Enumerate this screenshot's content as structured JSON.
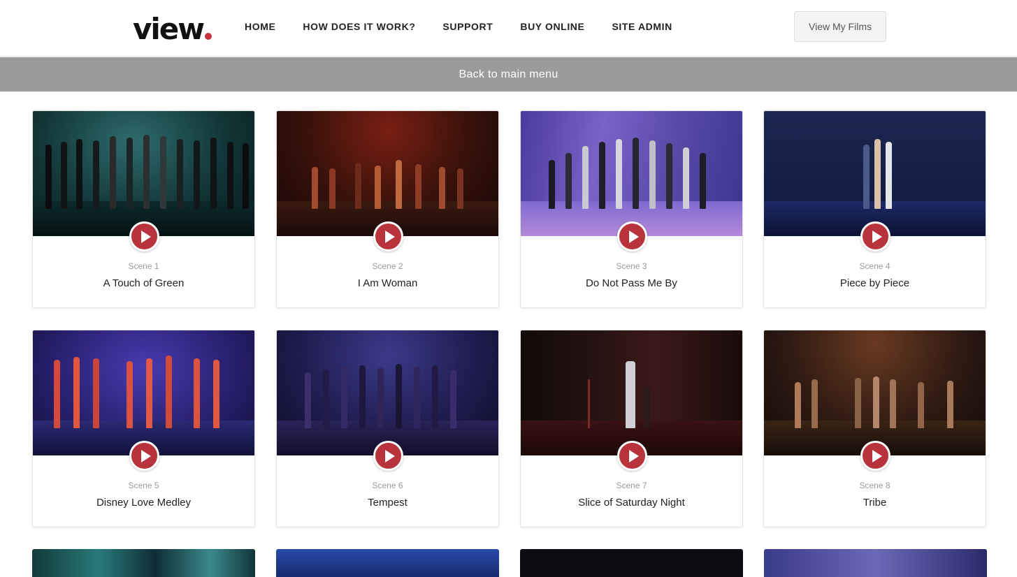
{
  "brand": {
    "logo_text": "view",
    "accent": "#c8323a"
  },
  "nav": {
    "items": [
      {
        "label": "HOME",
        "name": "nav-home"
      },
      {
        "label": "HOW DOES IT WORK?",
        "name": "nav-how-it-works"
      },
      {
        "label": "SUPPORT",
        "name": "nav-support"
      },
      {
        "label": "BUY ONLINE",
        "name": "nav-buy-online"
      },
      {
        "label": "SITE ADMIN",
        "name": "nav-site-admin"
      }
    ],
    "films_button": "View My Films"
  },
  "back_bar": {
    "label": "Back to main menu"
  },
  "scenes": [
    {
      "number": "Scene 1",
      "title": "A Touch of Green",
      "icon": "play-icon"
    },
    {
      "number": "Scene 2",
      "title": "I Am Woman",
      "icon": "play-icon"
    },
    {
      "number": "Scene 3",
      "title": "Do Not Pass Me By",
      "icon": "play-icon"
    },
    {
      "number": "Scene 4",
      "title": "Piece by Piece",
      "icon": "play-icon"
    },
    {
      "number": "Scene 5",
      "title": "Disney Love Medley",
      "icon": "play-icon"
    },
    {
      "number": "Scene 6",
      "title": "Tempest",
      "icon": "play-icon"
    },
    {
      "number": "Scene 7",
      "title": "Slice of Saturday Night",
      "icon": "play-icon"
    },
    {
      "number": "Scene 8",
      "title": "Tribe",
      "icon": "play-icon"
    }
  ],
  "colors": {
    "play_button": "#b8333b",
    "back_bar": "#9b9b9b",
    "muted_text": "#9a9a9a"
  }
}
